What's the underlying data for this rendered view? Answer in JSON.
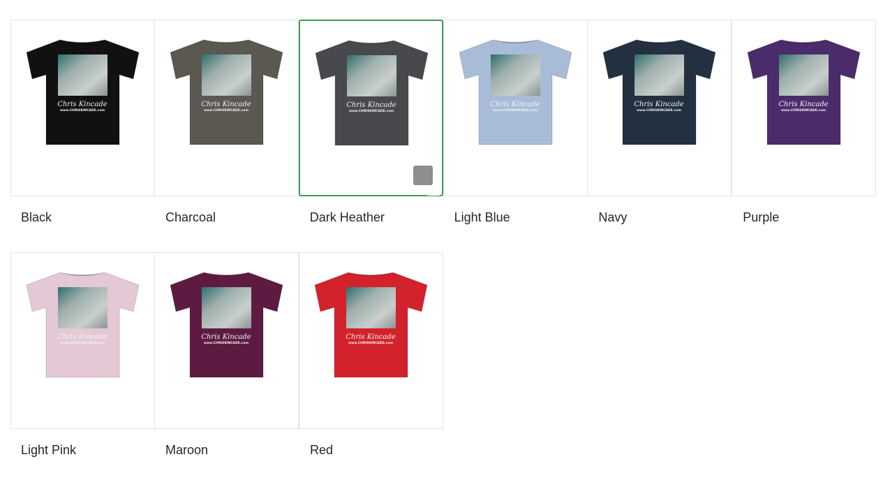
{
  "variants": [
    {
      "label": "Black",
      "color": "#111111",
      "selected": false
    },
    {
      "label": "Charcoal",
      "color": "#5b5751",
      "selected": false
    },
    {
      "label": "Dark Heather",
      "color": "#47494c",
      "selected": true
    },
    {
      "label": "Light Blue",
      "color": "#a9bcd7",
      "selected": false
    },
    {
      "label": "Navy",
      "color": "#22303f",
      "selected": false
    },
    {
      "label": "Purple",
      "color": "#4a2c6b",
      "selected": false
    },
    {
      "label": "Light Pink",
      "color": "#e4c8d6",
      "selected": false
    },
    {
      "label": "Maroon",
      "color": "#5e1b42",
      "selected": false
    },
    {
      "label": "Red",
      "color": "#d3222b",
      "selected": false
    }
  ],
  "print": {
    "brand_text": "Chris Kincade",
    "url_text": "www.CHRISKINCADE.com"
  },
  "icons": {
    "selected_badge": "image-icon"
  },
  "accent_color": "#3f9b55"
}
